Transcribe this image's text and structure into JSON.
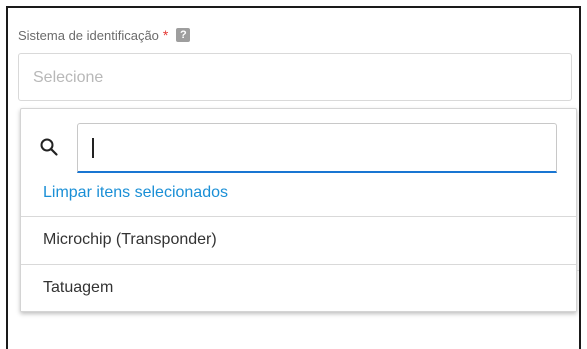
{
  "field": {
    "label": "Sistema de identificação",
    "required_mark": "*",
    "help_icon": "question-mark-icon",
    "help_glyph": "?",
    "placeholder": "Selecione"
  },
  "dropdown": {
    "search_icon": "search-icon",
    "search_value": "",
    "clear_label": "Limpar itens selecionados",
    "options": [
      {
        "label": "Microchip (Transponder)"
      },
      {
        "label": "Tatuagem"
      }
    ]
  },
  "colors": {
    "accent": "#1976d2",
    "link": "#1a8fd6",
    "required": "#e53935"
  }
}
